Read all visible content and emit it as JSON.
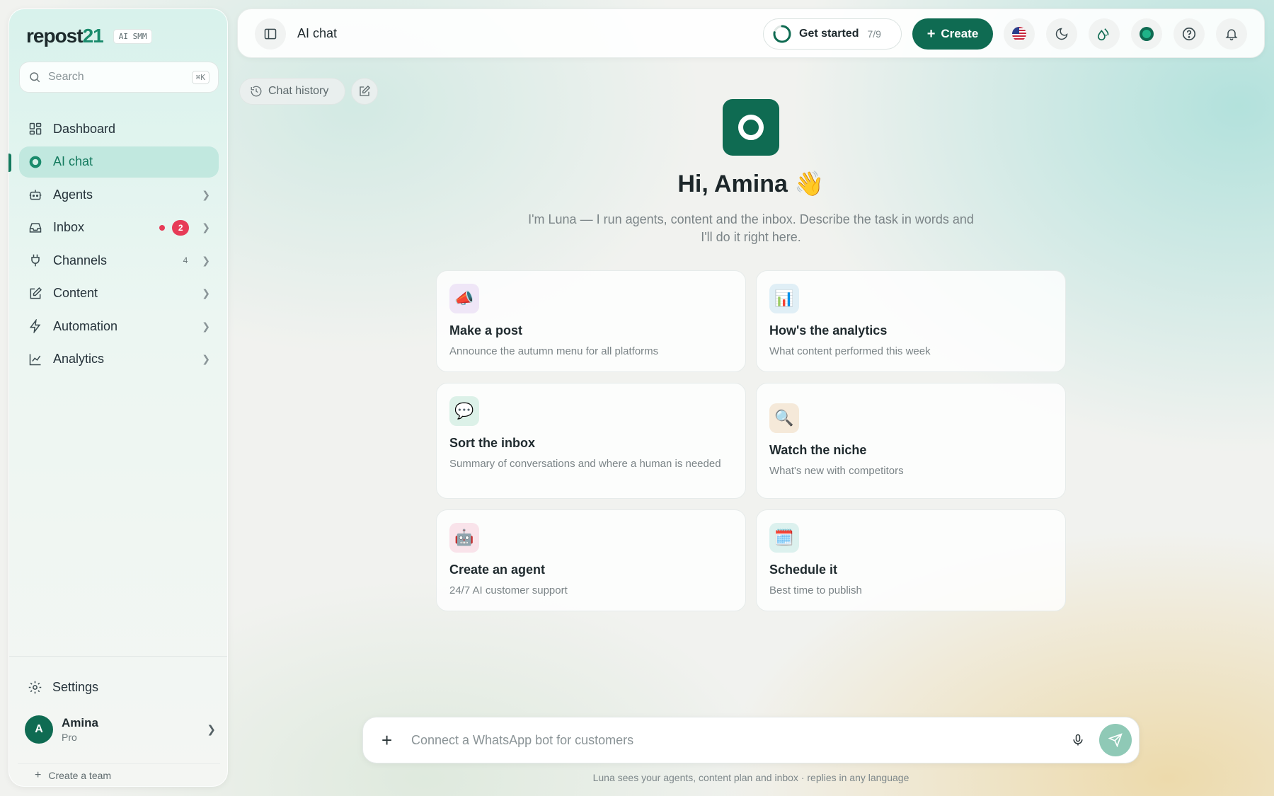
{
  "brand": {
    "name_part1": "repost",
    "name_part2": "21",
    "badge": "AI SMM"
  },
  "search": {
    "placeholder": "Search",
    "shortcut": "⌘K"
  },
  "nav": [
    {
      "label": "Dashboard",
      "icon": "dashboard-icon"
    },
    {
      "label": "AI chat",
      "icon": "ai-chat-icon",
      "active": true
    },
    {
      "label": "Agents",
      "icon": "robot-icon"
    },
    {
      "label": "Inbox",
      "icon": "inbox-icon",
      "badge": "2"
    },
    {
      "label": "Channels",
      "icon": "plug-icon",
      "count": "4"
    },
    {
      "label": "Content",
      "icon": "edit-icon"
    },
    {
      "label": "Automation",
      "icon": "bolt-icon"
    },
    {
      "label": "Analytics",
      "icon": "line-chart-icon"
    }
  ],
  "settings_label": "Settings",
  "user": {
    "initial": "A",
    "name": "Amina",
    "plan": "Pro"
  },
  "create_team": "Create a team",
  "topbar": {
    "title": "AI chat",
    "get_started": "Get started",
    "progress": "7/9",
    "progress_value": 0.78,
    "create": "Create"
  },
  "chat_history": "Chat history",
  "hero": {
    "greeting": "Hi, Amina 👋",
    "subtitle": "I'm Luna — I run agents, content and the inbox. Describe the task in words and I'll do it right here."
  },
  "cards": [
    {
      "icon": "📣",
      "title": "Make a post",
      "desc": "Announce the autumn menu for all platforms",
      "bg": "#efe6f7"
    },
    {
      "icon": "📊",
      "title": "How's the analytics",
      "desc": "What content performed this week",
      "bg": "#e0eff6"
    },
    {
      "icon": "💬",
      "title": "Sort the inbox",
      "desc": "Summary of conversations and where a human is needed",
      "bg": "#dcf1e8"
    },
    {
      "icon": "🔍",
      "title": "Watch the niche",
      "desc": "What's new with competitors",
      "bg": "#f5e9d9"
    },
    {
      "icon": "🤖",
      "title": "Create an agent",
      "desc": "24/7 AI customer support",
      "bg": "#f9e3ea"
    },
    {
      "icon": "🗓️",
      "title": "Schedule it",
      "desc": "Best time to publish",
      "bg": "#dcf1ee"
    }
  ],
  "composer": {
    "placeholder": "Connect a WhatsApp bot for customers"
  },
  "footnote": "Luna sees your agents, content plan and inbox · replies in any language",
  "colors": {
    "brand": "#0f6b52",
    "accent": "#1a8b6c",
    "alert": "#e73b57"
  }
}
